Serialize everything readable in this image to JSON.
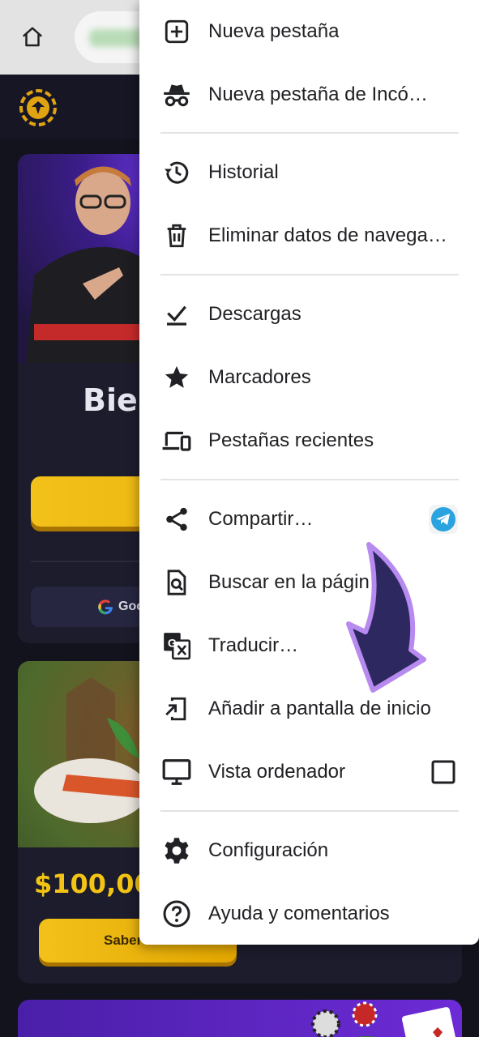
{
  "browser": {
    "home_icon": "home-icon"
  },
  "site": {
    "welcome_title": "Bien",
    "google_label": "Goo",
    "promo_amount": "$100,00",
    "saber_label": "Saber"
  },
  "menu": {
    "items": [
      {
        "label": "Nueva pestaña",
        "icon": "new-tab-icon"
      },
      {
        "label": "Nueva pestaña de Incó…",
        "icon": "incognito-icon"
      },
      {
        "label": "Historial",
        "icon": "history-icon"
      },
      {
        "label": "Eliminar datos de navega…",
        "icon": "trash-icon"
      },
      {
        "label": "Descargas",
        "icon": "download-icon"
      },
      {
        "label": "Marcadores",
        "icon": "star-icon"
      },
      {
        "label": "Pestañas recientes",
        "icon": "devices-icon"
      },
      {
        "label": "Compartir…",
        "icon": "share-icon"
      },
      {
        "label": "Buscar en la págin",
        "icon": "find-in-page-icon"
      },
      {
        "label": "Traducir…",
        "icon": "translate-icon"
      },
      {
        "label": "Añadir a pantalla de inicio",
        "icon": "add-to-home-screen-icon"
      },
      {
        "label": "Vista ordenador",
        "icon": "desktop-icon"
      },
      {
        "label": "Configuración",
        "icon": "gear-icon"
      },
      {
        "label": "Ayuda y comentarios",
        "icon": "help-icon"
      }
    ],
    "share_target_icon": "telegram-icon",
    "desktop_view_checked": false
  },
  "colors": {
    "accent_yellow": "#f2c11a",
    "arrow_fill": "#2d2860",
    "arrow_outline": "#b78af0",
    "telegram_blue": "#2aa3df"
  }
}
